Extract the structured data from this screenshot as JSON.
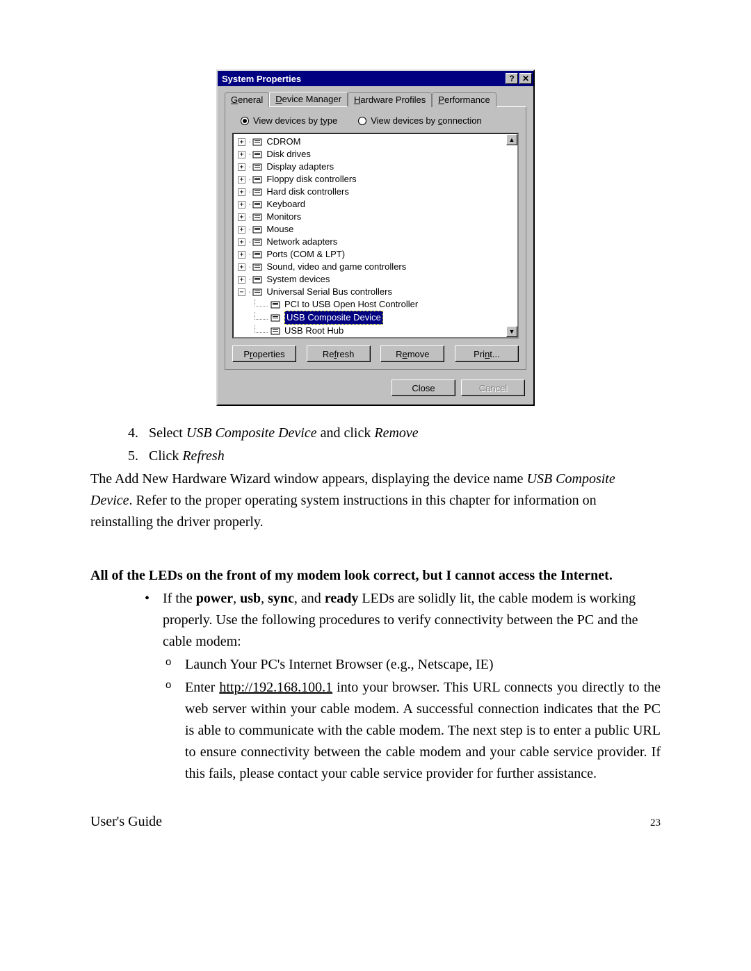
{
  "dialog": {
    "title": "System Properties",
    "help_glyph": "?",
    "close_glyph": "✕",
    "tabs": [
      {
        "label_pre": "",
        "label_ul": "G",
        "label_post": "eneral",
        "active": false
      },
      {
        "label_pre": "",
        "label_ul": "D",
        "label_post": "evice Manager",
        "active": true
      },
      {
        "label_pre": "",
        "label_ul": "H",
        "label_post": "ardware Profiles",
        "active": false
      },
      {
        "label_pre": "",
        "label_ul": "P",
        "label_post": "erformance",
        "active": false
      }
    ],
    "radios": {
      "by_type": {
        "pre": "View devices by ",
        "ul": "t",
        "post": "ype",
        "selected": true
      },
      "by_conn": {
        "pre": "View devices by ",
        "ul": "c",
        "post": "onnection",
        "selected": false
      }
    },
    "tree": {
      "nodes": [
        {
          "label": "CDROM",
          "exp": "+"
        },
        {
          "label": "Disk drives",
          "exp": "+"
        },
        {
          "label": "Display adapters",
          "exp": "+"
        },
        {
          "label": "Floppy disk controllers",
          "exp": "+"
        },
        {
          "label": "Hard disk controllers",
          "exp": "+"
        },
        {
          "label": "Keyboard",
          "exp": "+"
        },
        {
          "label": "Monitors",
          "exp": "+"
        },
        {
          "label": "Mouse",
          "exp": "+"
        },
        {
          "label": "Network adapters",
          "exp": "+"
        },
        {
          "label": "Ports (COM & LPT)",
          "exp": "+"
        },
        {
          "label": "Sound, video and game controllers",
          "exp": "+"
        },
        {
          "label": "System devices",
          "exp": "+"
        },
        {
          "label": "Universal Serial Bus controllers",
          "exp": "−",
          "children": [
            {
              "label": "PCI to USB Open Host Controller",
              "selected": false
            },
            {
              "label": "USB Composite Device",
              "selected": true
            },
            {
              "label": "USB Root Hub",
              "selected": false
            }
          ]
        }
      ],
      "scroll_up": "▲",
      "scroll_dn": "▼"
    },
    "buttons": {
      "properties": {
        "pre": "P",
        "ul": "r",
        "post": "operties"
      },
      "refresh": {
        "pre": "Re",
        "ul": "f",
        "post": "resh"
      },
      "remove": {
        "pre": "R",
        "ul": "e",
        "post": "move"
      },
      "print": {
        "pre": "Pri",
        "ul": "n",
        "post": "t..."
      }
    },
    "footer": {
      "close": "Close",
      "cancel": "Cancel"
    }
  },
  "doc": {
    "step4_num": "4.",
    "step4_a": "Select ",
    "step4_it": "USB Composite Device",
    "step4_b": " and click ",
    "step4_it2": "Remove",
    "step5_num": "5.",
    "step5_a": "Click ",
    "step5_it": "Refresh",
    "para1_a": "The Add New Hardware Wizard window appears, displaying the device name ",
    "para1_it": "USB Composite Device",
    "para1_b": ".  Refer to the proper operating system instructions in this chapter for information on reinstalling the driver properly.",
    "bold_head": "All of the LEDs on the front of my modem look correct, but I cannot access the Internet.",
    "bullet1_a": "If the ",
    "bullet1_b1": "power",
    "bullet1_s1": ", ",
    "bullet1_b2": "usb",
    "bullet1_s2": ", ",
    "bullet1_b3": "sync",
    "bullet1_s3": ", and ",
    "bullet1_b4": "ready",
    "bullet1_c": " LEDs are solidly lit, the cable modem is working properly.  Use the following procedures to verify connectivity between the PC and the cable modem:",
    "sub1": "Launch  Your PC's Internet Browser (e.g., Netscape, IE)",
    "sub2_a": "Enter ",
    "sub2_url": "http://192.168.100.1",
    "sub2_b": " into your browser.  This URL connects you directly to the web server within your cable modem. A successful connection indicates that the PC is able to communicate with the cable modem.  The next step is to enter a public URL to ensure connectivity between the cable modem and your cable service provider.  If this fails, please contact your cable service provider for further assistance.",
    "footer_left": "User's Guide",
    "footer_page": "23"
  }
}
